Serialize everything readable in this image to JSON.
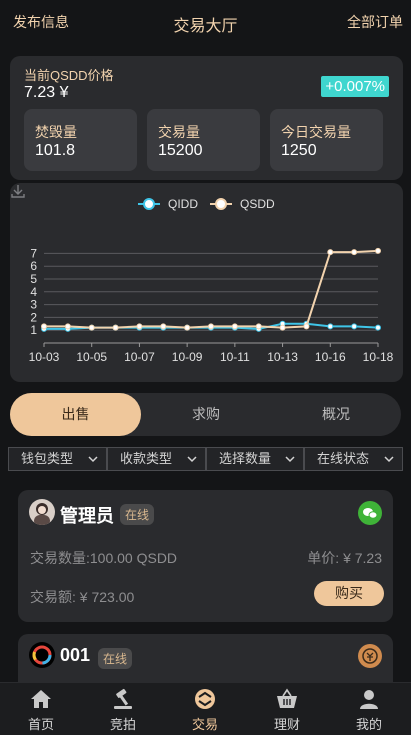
{
  "header": {
    "left_link": "发布信息",
    "title": "交易大厅",
    "right_link": "全部订单"
  },
  "price": {
    "label": "当前QSDD价格",
    "value": "7.23 ¥",
    "change": "+0.007%"
  },
  "stats": [
    {
      "label": "焚毁量",
      "value": "101.8"
    },
    {
      "label": "交易量",
      "value": "15200"
    },
    {
      "label": "今日交易量",
      "value": "1250"
    }
  ],
  "chart_data": {
    "type": "line",
    "x": [
      "10-03",
      "10-04",
      "10-05",
      "10-06",
      "10-07",
      "10-08",
      "10-09",
      "10-10",
      "10-11",
      "10-12",
      "10-13",
      "10-14",
      "10-16",
      "10-17",
      "10-18"
    ],
    "x_tick_labels": [
      "10-03",
      "10-05",
      "10-07",
      "10-09",
      "10-11",
      "10-13",
      "10-16",
      "10-18"
    ],
    "ylim": [
      0,
      7.5
    ],
    "y_ticks": [
      1,
      2,
      3,
      4,
      5,
      6,
      7
    ],
    "grid": true,
    "legend_position": "top-center",
    "series": [
      {
        "name": "QIDD",
        "color": "#3fc5e8",
        "values": [
          1.1,
          1.1,
          1.2,
          1.2,
          1.2,
          1.2,
          1.2,
          1.2,
          1.2,
          1.1,
          1.5,
          1.5,
          1.3,
          1.3,
          1.2
        ]
      },
      {
        "name": "QSDD",
        "color": "#f2d3ae",
        "values": [
          1.3,
          1.3,
          1.2,
          1.2,
          1.3,
          1.3,
          1.2,
          1.3,
          1.3,
          1.3,
          1.2,
          1.3,
          7.1,
          7.1,
          7.2
        ]
      }
    ]
  },
  "tabs": [
    {
      "label": "出售",
      "active": true
    },
    {
      "label": "求购",
      "active": false
    },
    {
      "label": "概况",
      "active": false
    }
  ],
  "filters": [
    "钱包类型",
    "收款类型",
    "选择数量",
    "在线状态"
  ],
  "orders": [
    {
      "name": "管理员",
      "status": "在线",
      "quantity": "交易数量:100.00 QSDD",
      "unit_price": "单价: ¥ 7.23",
      "amount": "交易额: ¥ 723.00",
      "buy_label": "购买",
      "pay_icon": "wechat-icon",
      "pay_color": "#3fb338"
    },
    {
      "name": "001",
      "status": "在线",
      "pay_icon": "coin-icon",
      "pay_color": "#d08b4e"
    }
  ],
  "nav": [
    {
      "label": "首页",
      "icon": "home-icon",
      "active": false
    },
    {
      "label": "竞拍",
      "icon": "gavel-icon",
      "active": false
    },
    {
      "label": "交易",
      "icon": "exchange-icon",
      "active": true
    },
    {
      "label": "理财",
      "icon": "basket-icon",
      "active": false
    },
    {
      "label": "我的",
      "icon": "user-icon",
      "active": false
    }
  ]
}
